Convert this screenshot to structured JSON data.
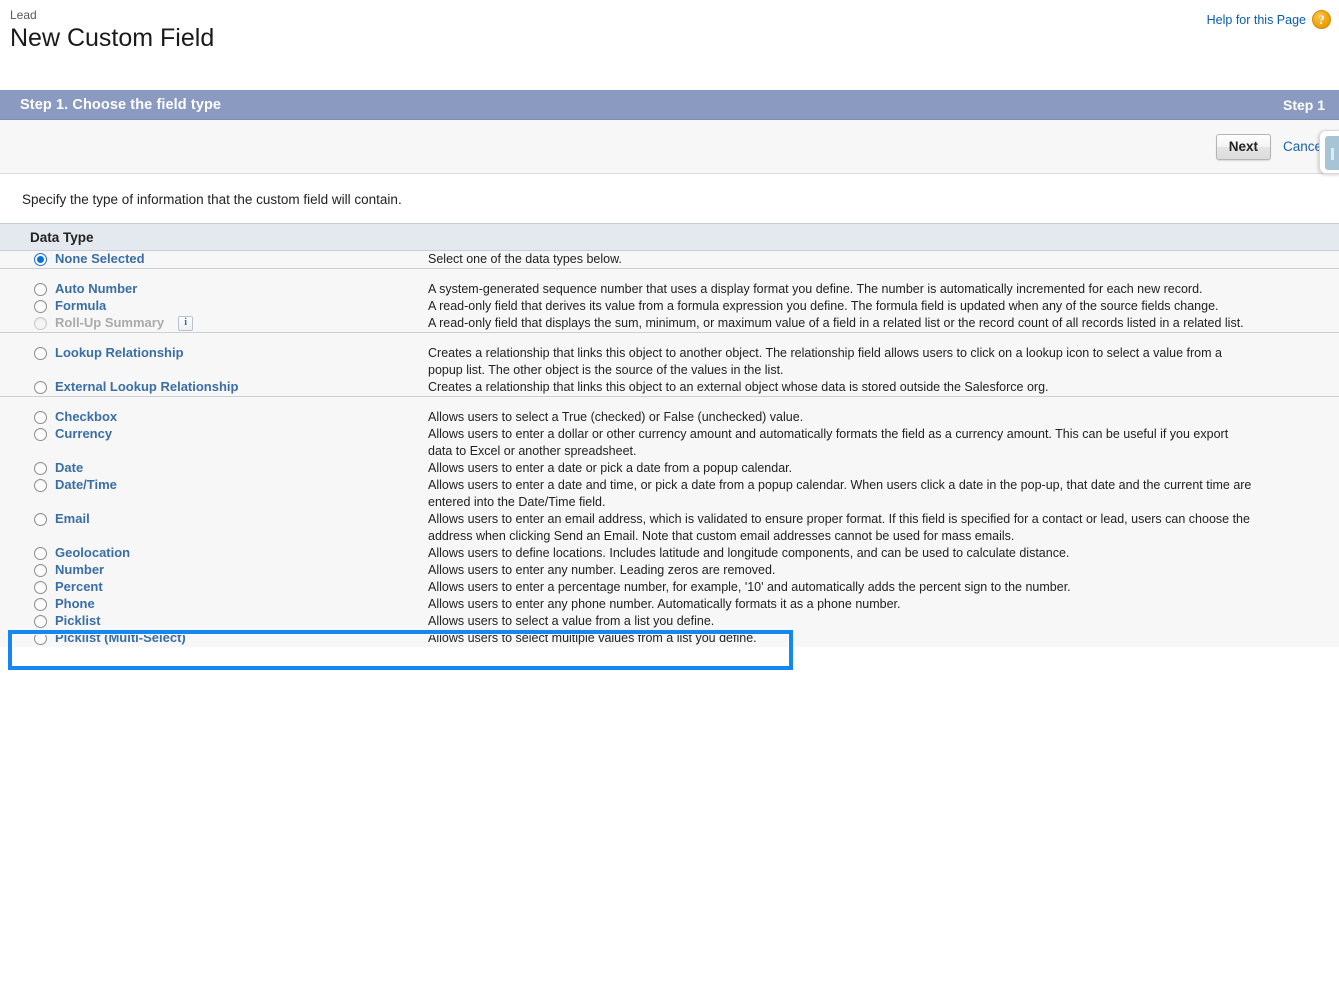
{
  "header": {
    "object_label": "Lead",
    "title": "New Custom Field",
    "help_link": "Help for this Page",
    "help_icon": "question-mark-icon"
  },
  "step_bar": {
    "title": "Step 1. Choose the field type",
    "step_indicator": "Step 1"
  },
  "actions": {
    "next_label": "Next",
    "cancel_label": "Cancel"
  },
  "intro_text": "Specify the type of information that the custom field will contain.",
  "section": {
    "title": "Data Type"
  },
  "selected_type": "None Selected",
  "groups": [
    {
      "options": [
        {
          "label": "None Selected",
          "description": "Select one of the data types below.",
          "selected": true,
          "disabled": false,
          "info_icon": false
        }
      ]
    },
    {
      "options": [
        {
          "label": "Auto Number",
          "description": "A system-generated sequence number that uses a display format you define. The number is automatically incremented for each new record.",
          "selected": false,
          "disabled": false,
          "info_icon": false
        },
        {
          "label": "Formula",
          "description": "A read-only field that derives its value from a formula expression you define. The formula field is updated when any of the source fields change.",
          "selected": false,
          "disabled": false,
          "info_icon": false
        },
        {
          "label": "Roll-Up Summary",
          "description": "A read-only field that displays the sum, minimum, or maximum value of a field in a related list or the record count of all records listed in a related list.",
          "selected": false,
          "disabled": true,
          "info_icon": true
        }
      ]
    },
    {
      "options": [
        {
          "label": "Lookup Relationship",
          "description": "Creates a relationship that links this object to another object. The relationship field allows users to click on a lookup icon to select a value from a popup list. The other object is the source of the values in the list.",
          "selected": false,
          "disabled": false,
          "info_icon": false
        },
        {
          "label": "External Lookup Relationship",
          "description": "Creates a relationship that links this object to an external object whose data is stored outside the Salesforce org.",
          "selected": false,
          "disabled": false,
          "info_icon": false
        }
      ]
    },
    {
      "options": [
        {
          "label": "Checkbox",
          "description": "Allows users to select a True (checked) or False (unchecked) value.",
          "selected": false,
          "disabled": false,
          "info_icon": false
        },
        {
          "label": "Currency",
          "description": "Allows users to enter a dollar or other currency amount and automatically formats the field as a currency amount. This can be useful if you export data to Excel or another spreadsheet.",
          "selected": false,
          "disabled": false,
          "info_icon": false
        },
        {
          "label": "Date",
          "description": "Allows users to enter a date or pick a date from a popup calendar.",
          "selected": false,
          "disabled": false,
          "info_icon": false
        },
        {
          "label": "Date/Time",
          "description": "Allows users to enter a date and time, or pick a date from a popup calendar. When users click a date in the pop-up, that date and the current time are entered into the Date/Time field.",
          "selected": false,
          "disabled": false,
          "info_icon": false
        },
        {
          "label": "Email",
          "description": "Allows users to enter an email address, which is validated to ensure proper format. If this field is specified for a contact or lead, users can choose the address when clicking Send an Email. Note that custom email addresses cannot be used for mass emails.",
          "selected": false,
          "disabled": false,
          "info_icon": false
        },
        {
          "label": "Geolocation",
          "description": "Allows users to define locations. Includes latitude and longitude components, and can be used to calculate distance.",
          "selected": false,
          "disabled": false,
          "info_icon": false
        },
        {
          "label": "Number",
          "description": "Allows users to enter any number. Leading zeros are removed.",
          "selected": false,
          "disabled": false,
          "info_icon": false
        },
        {
          "label": "Percent",
          "description": "Allows users to enter a percentage number, for example, '10' and automatically adds the percent sign to the number.",
          "selected": false,
          "disabled": false,
          "info_icon": false
        },
        {
          "label": "Phone",
          "description": "Allows users to enter any phone number. Automatically formats it as a phone number.",
          "selected": false,
          "disabled": false,
          "info_icon": false
        },
        {
          "label": "Picklist",
          "description": "Allows users to select a value from a list you define.",
          "selected": false,
          "disabled": false,
          "info_icon": false
        },
        {
          "label": "Picklist (Multi-Select)",
          "description": "Allows users to select multiple values from a list you define.",
          "selected": false,
          "disabled": false,
          "info_icon": false,
          "highlighted": true
        }
      ]
    }
  ],
  "colors": {
    "step_bar_bg": "#8a9ac1",
    "section_header_bg": "#e4e8ef",
    "link_blue": "#3a6ea5",
    "highlight_border": "#1487f0",
    "help_link_blue": "#0b5cab",
    "page_bg": "#f7f7f7"
  }
}
